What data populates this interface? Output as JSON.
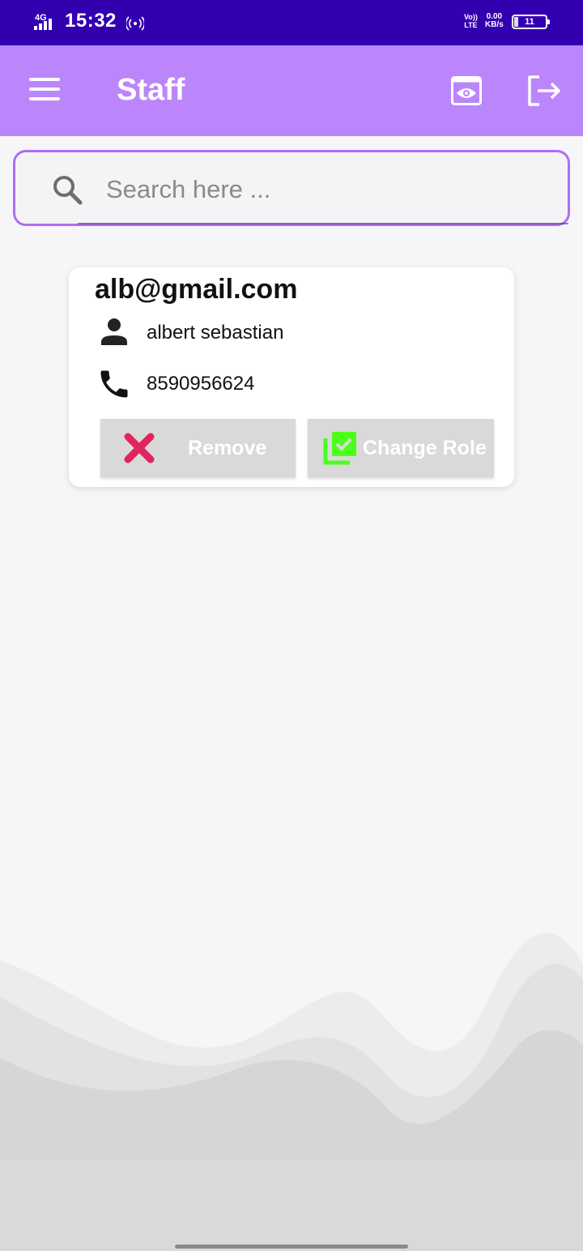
{
  "status_bar": {
    "network": "4G",
    "time": "15:32",
    "volte_top": "Vo))",
    "volte_bottom": "LTE",
    "speed_value": "0.00",
    "speed_unit": "KB/s",
    "battery": "11"
  },
  "app_bar": {
    "title": "Staff",
    "menu_icon": "hamburger-menu-icon",
    "view_icon": "eye-icon",
    "logout_icon": "logout-icon"
  },
  "search": {
    "placeholder": "Search here ...",
    "value": ""
  },
  "staff": [
    {
      "email": "alb@gmail.com",
      "name": "albert sebastian",
      "phone": "8590956624",
      "remove_label": "Remove",
      "change_role_label": "Change Role"
    }
  ],
  "colors": {
    "status_bar": "#3300b0",
    "app_bar": "#bb86fc",
    "search_border": "#b06ef0",
    "remove_icon": "#e0245e",
    "change_role_icon": "#4cff1a"
  }
}
